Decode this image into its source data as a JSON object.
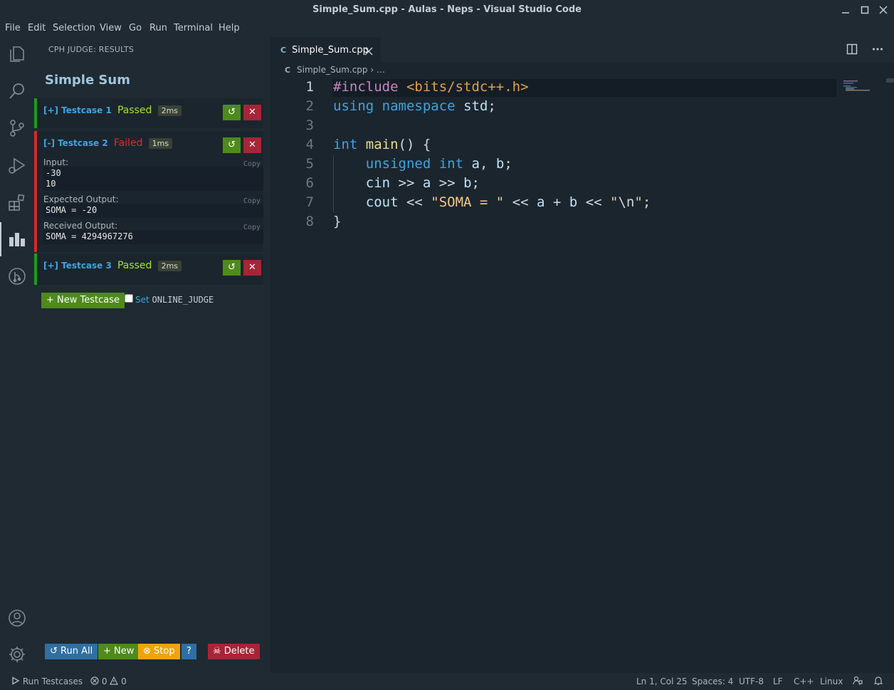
{
  "window": {
    "title": "Simple_Sum.cpp - Aulas - Neps - Visual Studio Code"
  },
  "menu": [
    "File",
    "Edit",
    "Selection",
    "View",
    "Go",
    "Run",
    "Terminal",
    "Help"
  ],
  "activity_bar": {
    "icons": [
      "explorer-icon",
      "search-icon",
      "source-control-icon",
      "run-debug-icon",
      "extensions-icon",
      "cph-judge-icon",
      "git-graph-icon",
      "account-icon",
      "settings-gear-icon"
    ],
    "active": "cph-judge-icon"
  },
  "sidebar": {
    "title": "CPH JUDGE: RESULTS",
    "problem_name": "Simple Sum",
    "testcases": [
      {
        "toggle": "[+]",
        "name": "Testcase 1",
        "status": "Passed",
        "time": "2ms"
      },
      {
        "toggle": "[-]",
        "name": "Testcase 2",
        "status": "Failed",
        "time": "1ms",
        "input_label": "Input:",
        "input_lines": [
          "-30",
          "10"
        ],
        "expected_label": "Expected Output:",
        "expected": "SOMA = -20",
        "received_label": "Received Output:",
        "received": "SOMA = 4294967276",
        "copy_label": "Copy"
      },
      {
        "toggle": "[+]",
        "name": "Testcase 3",
        "status": "Passed",
        "time": "2ms"
      }
    ],
    "rerun_glyph": "↺",
    "delete_glyph": "✕",
    "new_testcase_label": "+ New Testcase",
    "online_judge_prefix": "Set",
    "online_judge_code": "ONLINE_JUDGE",
    "online_judge_checked": false,
    "bottom_buttons": {
      "run_all": "↺ Run All",
      "new": "+ New",
      "stop": "⊗ Stop",
      "help": "?",
      "delete": "☠ Delete"
    }
  },
  "editor": {
    "tab_label": "Simple_Sum.cpp",
    "breadcrumb_file": "Simple_Sum.cpp",
    "breadcrumb_rest": "…",
    "line_numbers": [
      "1",
      "2",
      "3",
      "4",
      "5",
      "6",
      "7",
      "8"
    ],
    "active_line": "1"
  },
  "statusbar": {
    "run_testcases": "Run Testcases",
    "errors": "0",
    "warnings": "0",
    "position": "Ln 1, Col 25",
    "spaces": "Spaces: 4",
    "encoding": "UTF-8",
    "eol": "LF",
    "language": "C++",
    "os": "Linux"
  },
  "colors": {
    "background": "#1f2a33",
    "editor_background": "#1b252e",
    "pass_green": "#1a9d1a",
    "fail_red": "#d42b2b",
    "button_green": "#4e8a1c",
    "button_red": "#a62537",
    "button_blue": "#2f6fa3",
    "button_orange": "#f0a30a"
  }
}
